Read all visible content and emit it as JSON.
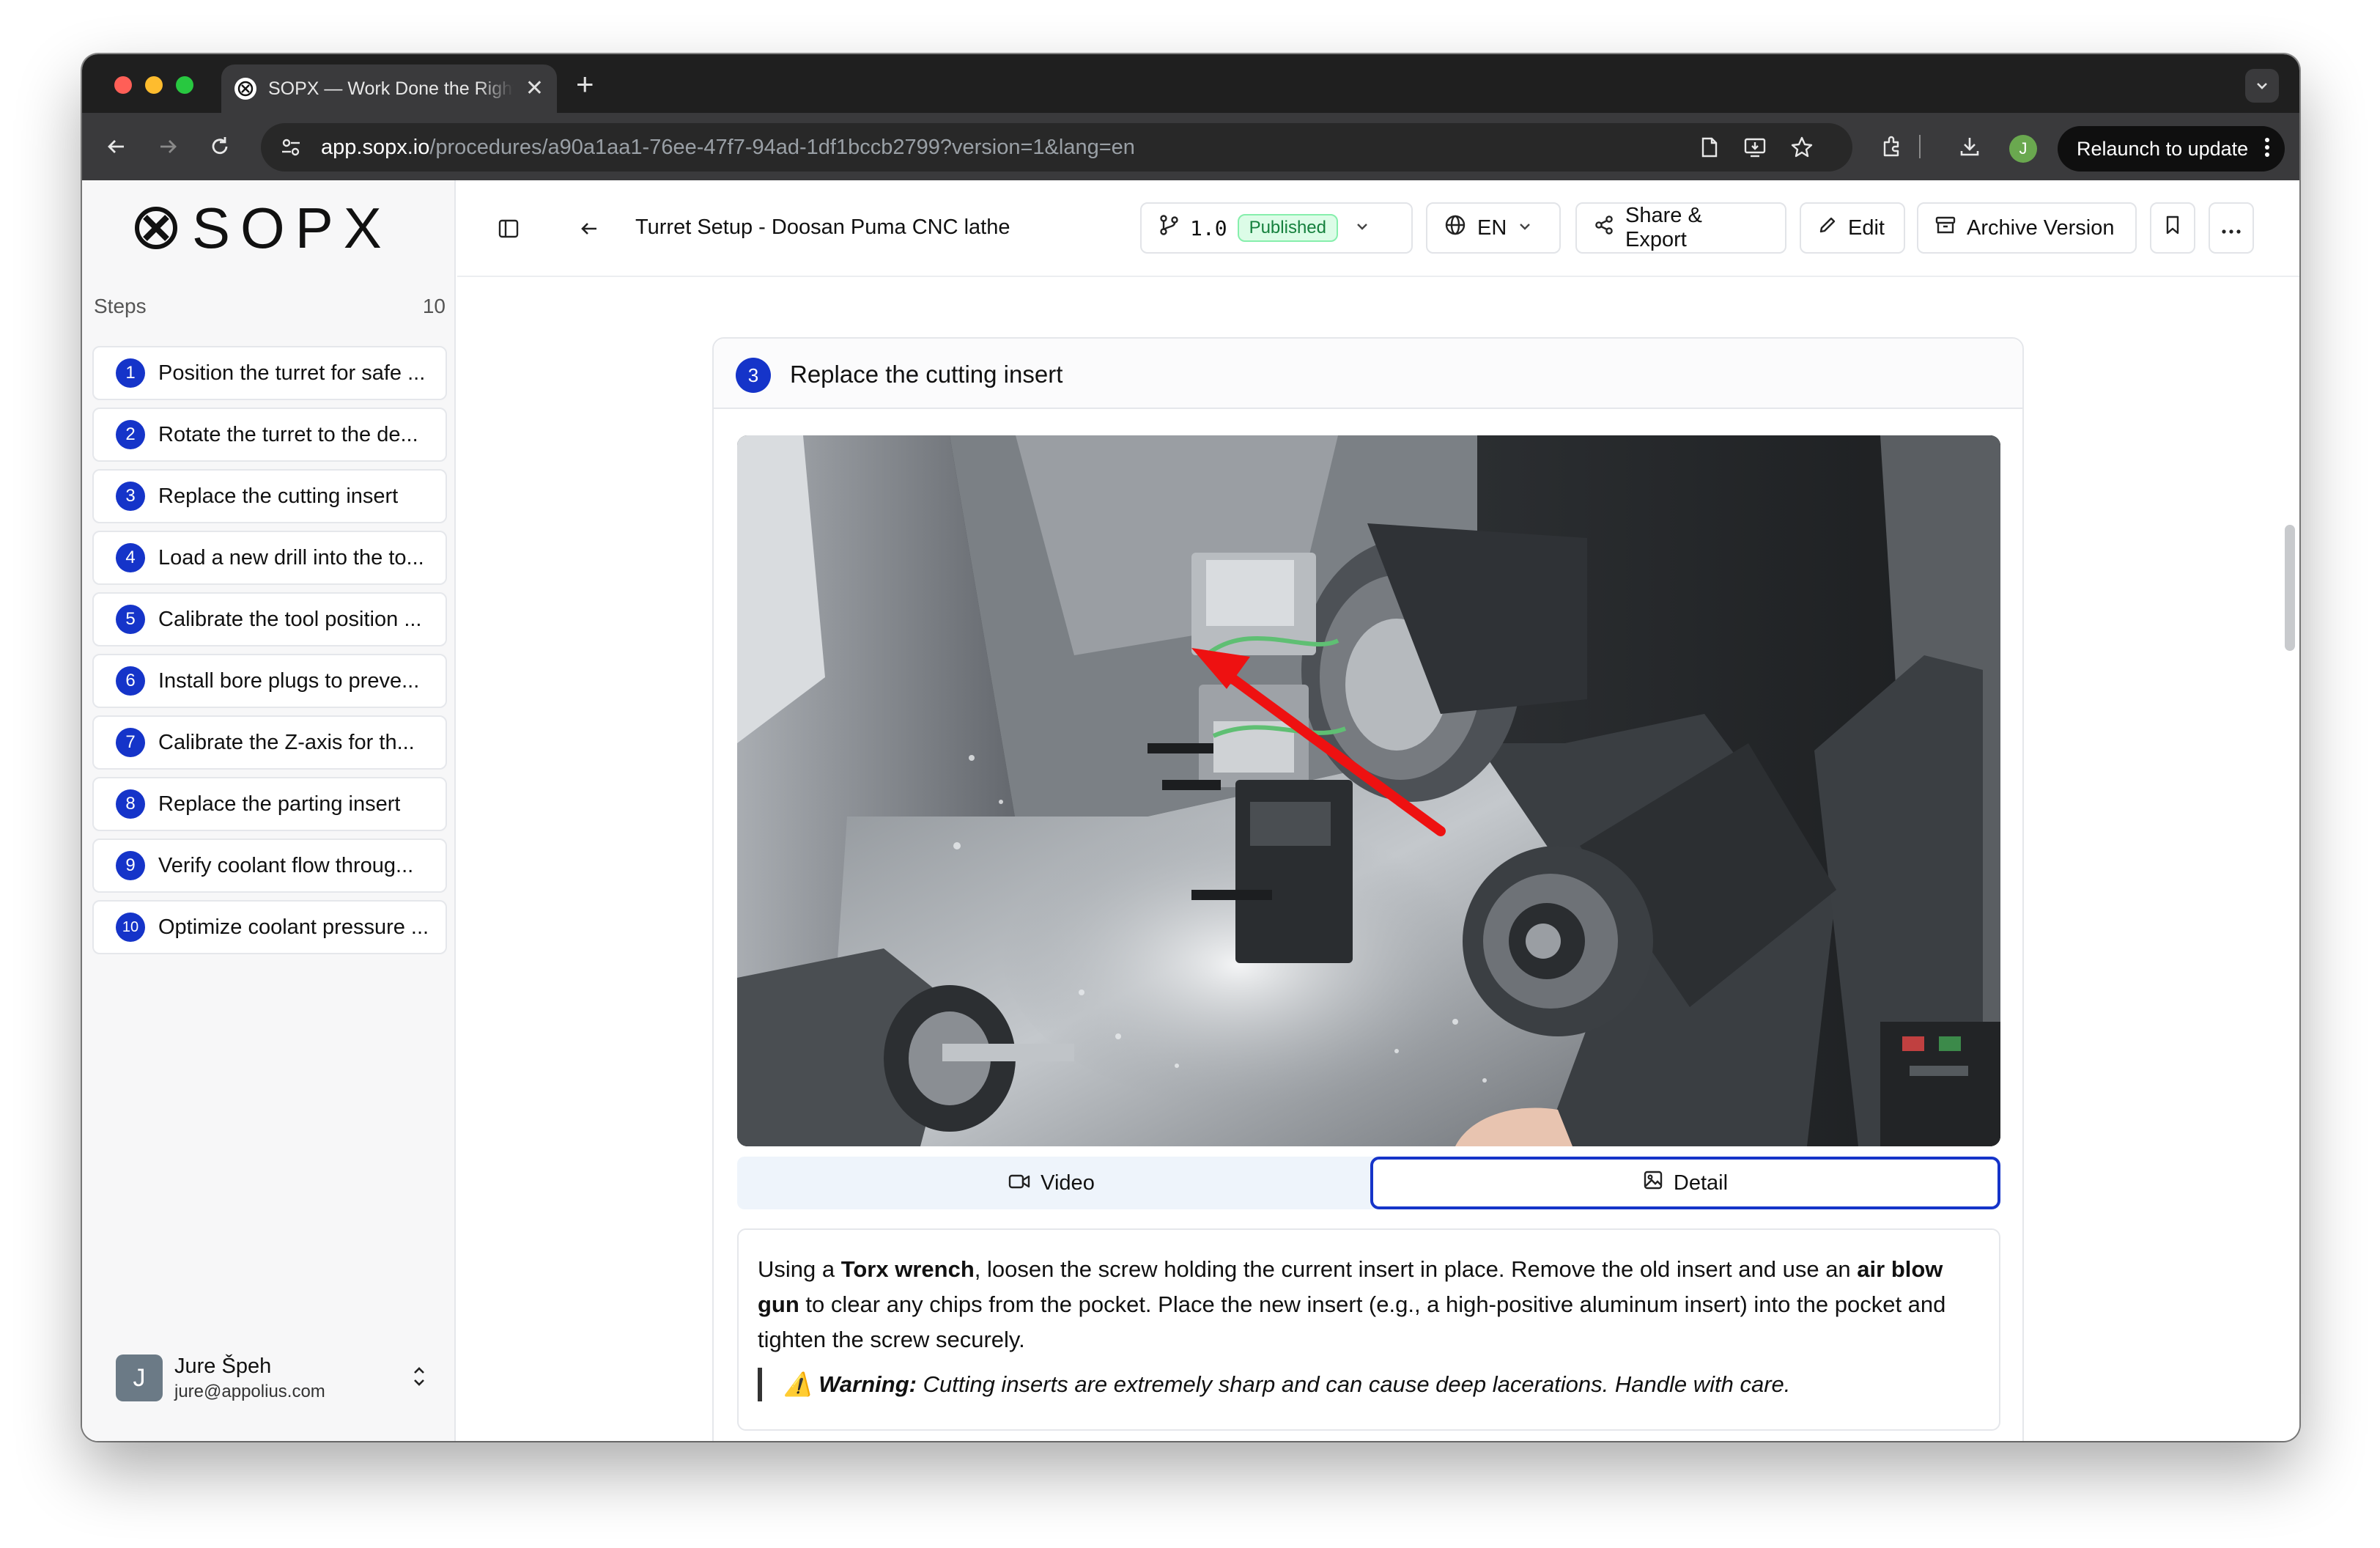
{
  "browser": {
    "tab_title": "SOPX — Work Done the Right Way",
    "url_host": "app.sopx.io",
    "url_path": "/procedures/a90a1aa1-76ee-47f7-94ad-1df1bccb2799?version=1&lang=en",
    "profile_initial": "J",
    "relaunch_label": "Relaunch to update"
  },
  "sidebar": {
    "logo_text": "SOPX",
    "steps_label": "Steps",
    "steps_count": "10",
    "steps": [
      {
        "num": "1",
        "label": "Position the turret for safe ..."
      },
      {
        "num": "2",
        "label": "Rotate the turret to the de..."
      },
      {
        "num": "3",
        "label": "Replace the cutting insert"
      },
      {
        "num": "4",
        "label": "Load a new drill into the to..."
      },
      {
        "num": "5",
        "label": "Calibrate the tool position ..."
      },
      {
        "num": "6",
        "label": "Install bore plugs to preve..."
      },
      {
        "num": "7",
        "label": "Calibrate the Z-axis for th..."
      },
      {
        "num": "8",
        "label": "Replace the parting insert"
      },
      {
        "num": "9",
        "label": "Verify coolant flow throug..."
      },
      {
        "num": "10",
        "label": "Optimize coolant pressure ..."
      }
    ],
    "user": {
      "initial": "J",
      "name": "Jure Špeh",
      "email": "jure@appolius.com"
    }
  },
  "header": {
    "title": "Turret Setup - Doosan Puma CNC lathe",
    "version": "1.0",
    "status": "Published",
    "language": "EN",
    "share_label": "Share & Export",
    "edit_label": "Edit",
    "archive_label": "Archive Version"
  },
  "step": {
    "number": "3",
    "title": "Replace the cutting insert",
    "media_tabs": {
      "video": "Video",
      "detail": "Detail",
      "active": "Detail"
    },
    "desc": {
      "t1": "Using a ",
      "b1": "Torx wrench",
      "t2": ", loosen the screw holding the current insert in place. Remove the old insert and use an ",
      "b2": "air blow gun",
      "t3": " to clear any chips from the pocket. Place the new insert (e.g., a high-positive aluminum insert) into the pocket and tighten the screw securely."
    },
    "warning": {
      "icon": "⚠️",
      "label": "Warning:",
      "text": " Cutting inserts are extremely sharp and can cause deep lacerations. Handle with care."
    }
  },
  "colors": {
    "accent": "#1534c9",
    "published_bg": "#dcfce7",
    "published_text": "#15803d",
    "arrow": "#ee1111"
  }
}
